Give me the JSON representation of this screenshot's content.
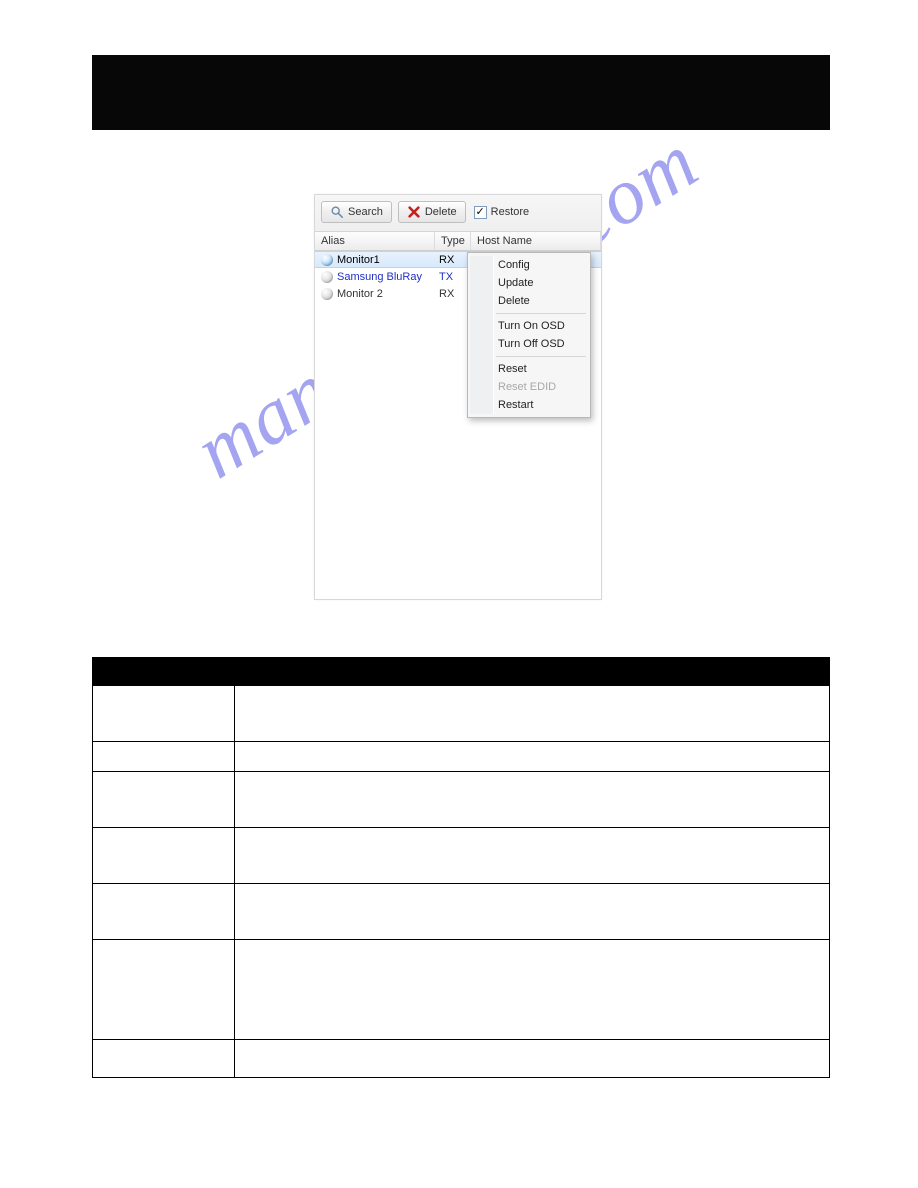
{
  "watermark": "manualshive.com",
  "toolbar": {
    "search_label": "Search",
    "delete_label": "Delete",
    "restore_label": "Restore",
    "restore_checked": true
  },
  "columns": {
    "alias": "Alias",
    "type": "Type",
    "host": "Host Name"
  },
  "rows": [
    {
      "alias": "Monitor1",
      "type": "RX",
      "selected": true,
      "tx": false,
      "dot": "blue"
    },
    {
      "alias": "Samsung BluRay",
      "type": "TX",
      "selected": false,
      "tx": true,
      "dot": "grey"
    },
    {
      "alias": "Monitor 2",
      "type": "RX",
      "selected": false,
      "tx": false,
      "dot": "grey"
    }
  ],
  "context_menu": [
    {
      "label": "Config",
      "enabled": true
    },
    {
      "label": "Update",
      "enabled": true
    },
    {
      "label": "Delete",
      "enabled": true
    },
    {
      "sep": true
    },
    {
      "label": "Turn On OSD",
      "enabled": true
    },
    {
      "label": "Turn Off OSD",
      "enabled": true
    },
    {
      "sep": true
    },
    {
      "label": "Reset",
      "enabled": true
    },
    {
      "label": "Reset EDID",
      "enabled": false
    },
    {
      "label": "Restart",
      "enabled": true
    }
  ]
}
